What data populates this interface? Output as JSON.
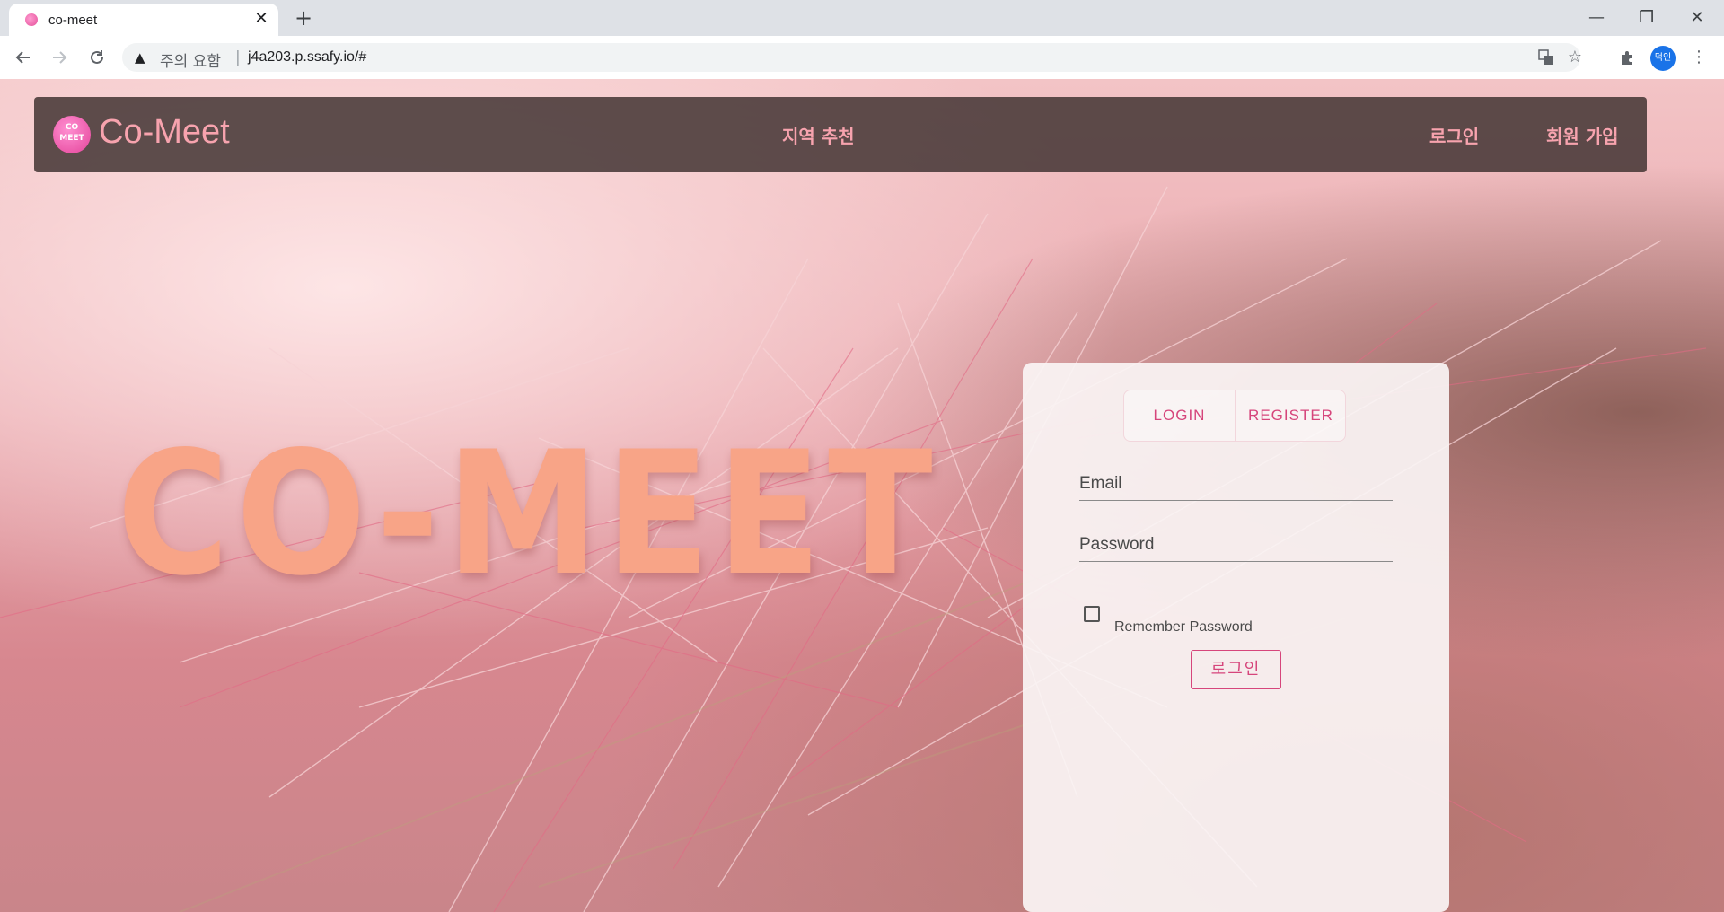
{
  "browser": {
    "tab_title": "co-meet",
    "tab_close": "✕",
    "new_tab": "+",
    "security_label": "주의 요함",
    "url": "j4a203.p.ssafy.io/#",
    "profile_initials": "덕인",
    "window_minimize": "—",
    "window_restore": "❐",
    "window_close": "✕"
  },
  "navbar": {
    "logo_text": "CO MEET",
    "brand": "Co-Meet",
    "link_region": "지역 추천",
    "link_login": "로그인",
    "link_signup": "회원 가입"
  },
  "hero": {
    "title": "CO-MEET"
  },
  "auth_card": {
    "tab_login": "LOGIN",
    "tab_register": "REGISTER",
    "email_label": "Email",
    "password_label": "Password",
    "remember_label": "Remember Password",
    "remember_checked": false,
    "submit_label": "로그인"
  },
  "colors": {
    "accent_pink": "#d6457b",
    "hero_salmon": "#f8a487",
    "nav_link_pink": "#f7a3ae"
  }
}
